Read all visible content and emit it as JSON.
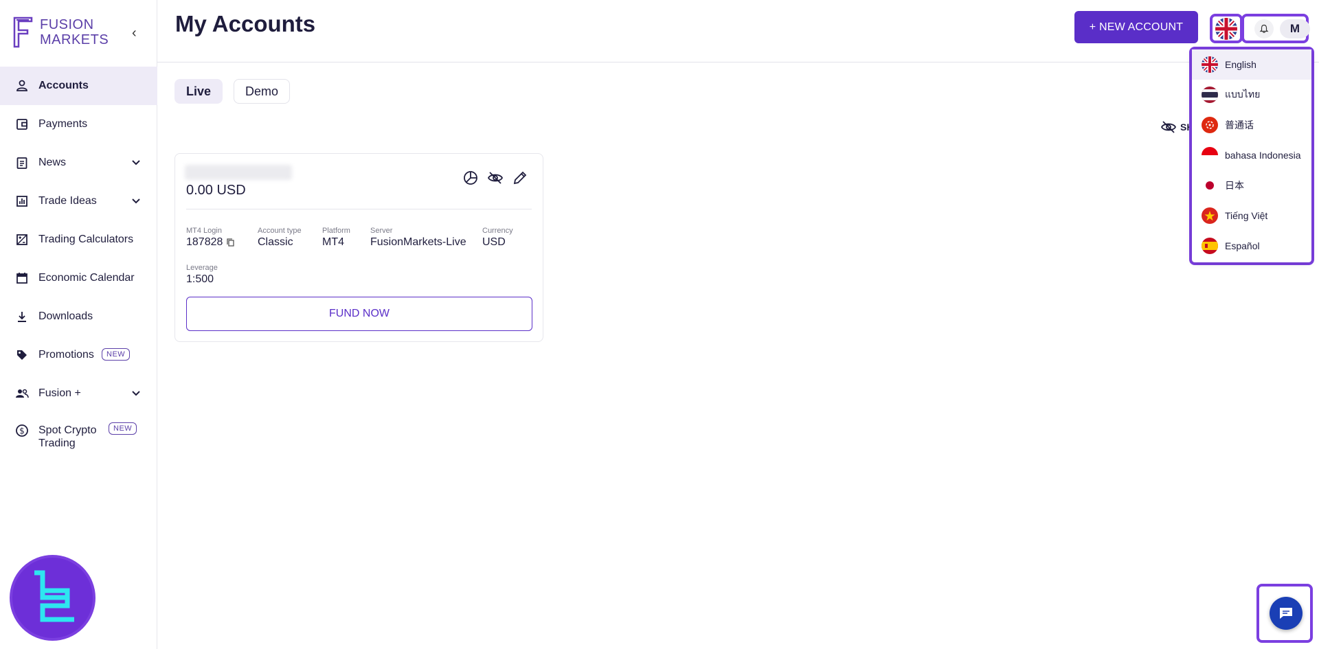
{
  "brand": {
    "line1": "FUSION",
    "line2": "MARKETS"
  },
  "sidebar": {
    "items": [
      {
        "label": "Accounts",
        "icon": "user-icon",
        "active": true
      },
      {
        "label": "Payments",
        "icon": "wallet-icon"
      },
      {
        "label": "News",
        "icon": "clipboard-icon",
        "expandable": true
      },
      {
        "label": "Trade Ideas",
        "icon": "bar-chart-icon",
        "expandable": true
      },
      {
        "label": "Trading Calculators",
        "icon": "calculator-icon"
      },
      {
        "label": "Economic Calendar",
        "icon": "calendar-icon"
      },
      {
        "label": "Downloads",
        "icon": "download-icon"
      },
      {
        "label": "Promotions",
        "icon": "tag-icon",
        "badge": "NEW"
      },
      {
        "label": "Fusion +",
        "icon": "users-icon",
        "expandable": true
      },
      {
        "label": "Spot Crypto Trading",
        "icon": "dollar-circle-icon",
        "badge": "NEW"
      }
    ]
  },
  "header": {
    "title": "My Accounts",
    "new_account_label": "+ NEW ACCOUNT",
    "avatar_initial": "M"
  },
  "tabs": [
    {
      "label": "Live",
      "active": true
    },
    {
      "label": "Demo",
      "active": false
    }
  ],
  "show_toggle_label": "SH",
  "account_card": {
    "balance": "0.00 USD",
    "fields": {
      "mt4_login": {
        "key": "MT4 Login",
        "value": "187828"
      },
      "account_type": {
        "key": "Account type",
        "value": "Classic"
      },
      "platform": {
        "key": "Platform",
        "value": "MT4"
      },
      "server": {
        "key": "Server",
        "value": "FusionMarkets-Live"
      },
      "currency": {
        "key": "Currency",
        "value": "USD"
      },
      "leverage": {
        "key": "Leverage",
        "value": "1:500"
      }
    },
    "fund_label": "FUND NOW"
  },
  "languages": [
    {
      "label": "English",
      "flag": "uk-flag-icon",
      "active": true
    },
    {
      "label": "แบบไทย",
      "flag": "thailand-flag-icon"
    },
    {
      "label": "普通话",
      "flag": "hongkong-flag-icon"
    },
    {
      "label": "bahasa Indonesia",
      "flag": "indonesia-flag-icon"
    },
    {
      "label": "日本",
      "flag": "japan-flag-icon"
    },
    {
      "label": "Tiếng Việt",
      "flag": "vietnam-flag-icon"
    },
    {
      "label": "Español",
      "flag": "spain-flag-icon"
    }
  ],
  "colors": {
    "accent": "#5a2ec8",
    "highlight": "#7b3fe0",
    "text": "#1f1d3d",
    "active_bg": "#eeebf7"
  }
}
